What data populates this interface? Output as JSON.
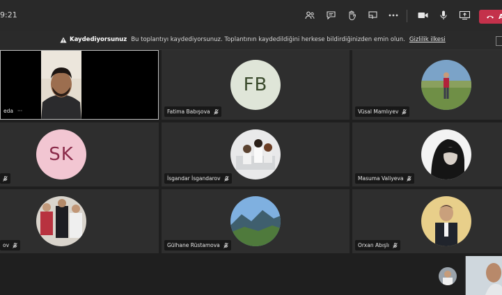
{
  "topbar": {
    "timer": "9:21",
    "icons": [
      "participants-icon",
      "chat-icon",
      "raise-hand-icon",
      "share-tray-icon",
      "more-icon",
      "camera-icon",
      "mic-icon",
      "share-screen-icon"
    ],
    "leave_label": "A",
    "leave_color": "#c4314b"
  },
  "banner": {
    "title": "Kaydediyorsunuz",
    "message": "Bu toplantıyı kaydediyorsunuz. Toplantının kaydedildiğini herkese bildirdiğinizden emin olun.",
    "link": "Gizlilik ilkesi"
  },
  "presenter": {
    "name_fragment": "eda",
    "more": "···"
  },
  "participants": [
    {
      "name": "Fatima Babışova",
      "initials": "FB",
      "avatar_color": "#dfe5d8",
      "initials_color": "#3a4a2c"
    },
    {
      "name": "Vüsal Mamlıyev"
    },
    {
      "initials": "SK",
      "avatar_color": "#f2c6d2",
      "initials_color": "#8a2b4a"
    },
    {
      "name": "İsgandar İsgandarov"
    },
    {
      "name": "Masuma Valiyeva"
    },
    {
      "name": "Gülhane Rüstamova"
    },
    {
      "name": "Orxan Abışlı"
    }
  ],
  "colors": {
    "tile": "#2e2e2e",
    "background": "#1f1f1f",
    "topbar": "#292929"
  }
}
